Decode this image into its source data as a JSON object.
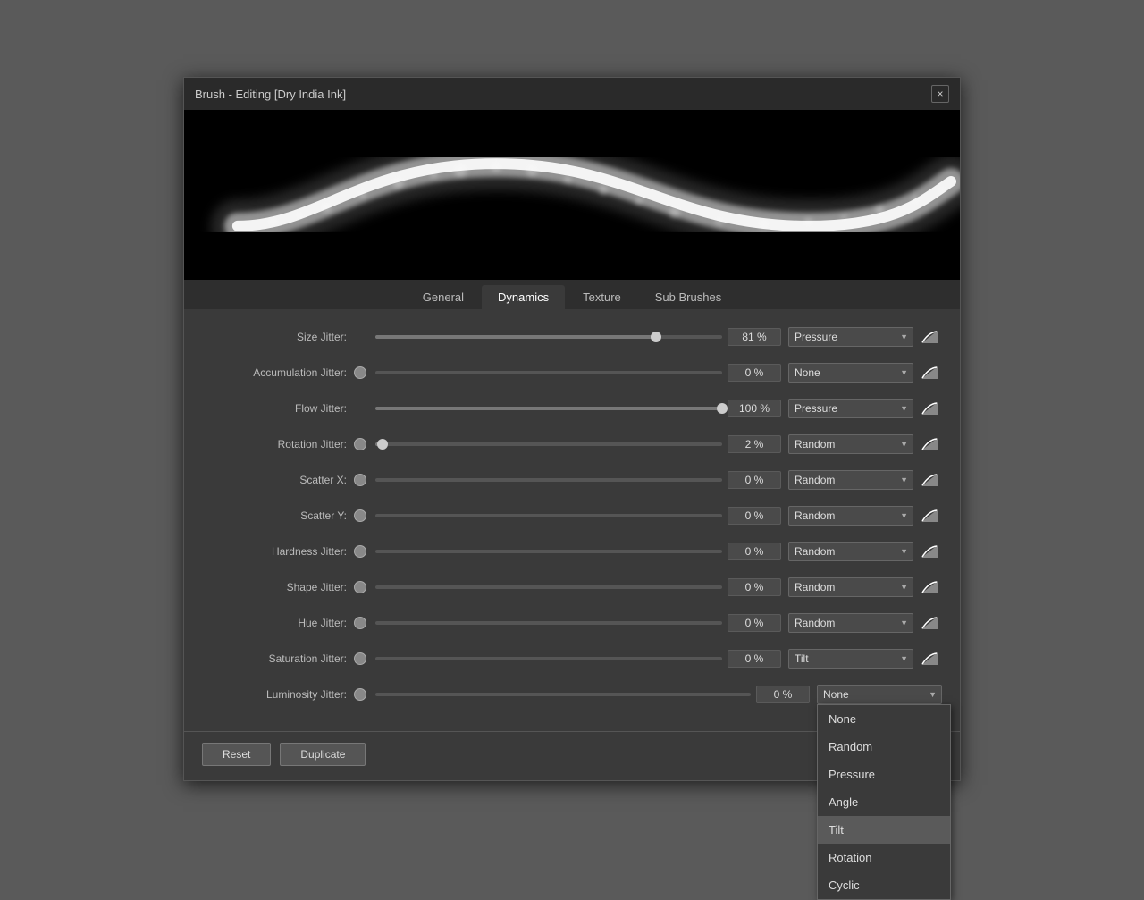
{
  "dialog": {
    "title": "Brush - Editing [Dry India Ink]",
    "close_label": "×"
  },
  "tabs": [
    {
      "label": "General",
      "active": false
    },
    {
      "label": "Dynamics",
      "active": true
    },
    {
      "label": "Texture",
      "active": false
    },
    {
      "label": "Sub Brushes",
      "active": false
    }
  ],
  "rows": [
    {
      "label": "Size Jitter:",
      "has_dot": false,
      "has_slider": true,
      "slider_pct": 81,
      "value": "81 %",
      "dropdown": "Pressure",
      "has_curve": true
    },
    {
      "label": "Accumulation Jitter:",
      "has_dot": true,
      "has_slider": false,
      "slider_pct": 0,
      "value": "0 %",
      "dropdown": "None",
      "has_curve": true
    },
    {
      "label": "Flow Jitter:",
      "has_dot": false,
      "has_slider": true,
      "slider_pct": 100,
      "value": "100 %",
      "dropdown": "Pressure",
      "has_curve": true
    },
    {
      "label": "Rotation Jitter:",
      "has_dot": true,
      "has_slider": false,
      "slider_pct": 2,
      "value": "2 %",
      "dropdown": "Random",
      "has_curve": true
    },
    {
      "label": "Scatter X:",
      "has_dot": true,
      "has_slider": false,
      "slider_pct": 0,
      "value": "0 %",
      "dropdown": "Random",
      "has_curve": true
    },
    {
      "label": "Scatter Y:",
      "has_dot": true,
      "has_slider": false,
      "slider_pct": 0,
      "value": "0 %",
      "dropdown": "Random",
      "has_curve": true
    },
    {
      "label": "Hardness Jitter:",
      "has_dot": true,
      "has_slider": false,
      "slider_pct": 0,
      "value": "0 %",
      "dropdown": "Random",
      "has_curve": true
    },
    {
      "label": "Shape Jitter:",
      "has_dot": true,
      "has_slider": false,
      "slider_pct": 0,
      "value": "0 %",
      "dropdown": "Random",
      "has_curve": true
    },
    {
      "label": "Hue Jitter:",
      "has_dot": true,
      "has_slider": false,
      "slider_pct": 0,
      "value": "0 %",
      "dropdown": "Random",
      "has_curve": true
    },
    {
      "label": "Saturation Jitter:",
      "has_dot": true,
      "has_slider": false,
      "slider_pct": 0,
      "value": "0 %",
      "dropdown": "Tilt",
      "has_curve": true
    },
    {
      "label": "Luminosity Jitter:",
      "has_dot": true,
      "has_slider": false,
      "slider_pct": 0,
      "value": "0 %",
      "dropdown": "None",
      "has_curve": false
    }
  ],
  "dropdown_options": [
    "None",
    "Random",
    "Pressure",
    "Angle",
    "Tilt",
    "Rotation",
    "Cyclic"
  ],
  "open_dropdown_row": 10,
  "open_dropdown_selected": "Tilt",
  "footer": {
    "reset_label": "Reset",
    "duplicate_label": "Duplicate"
  }
}
